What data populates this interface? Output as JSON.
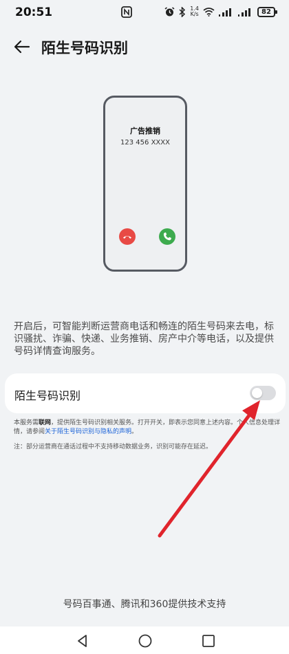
{
  "status_bar": {
    "time": "20:51",
    "net_speed_value": "1.4",
    "net_speed_unit": "K/s",
    "battery": "82"
  },
  "header": {
    "title": "陌生号码识别"
  },
  "phone_illustration": {
    "caller_name": "广告推销",
    "caller_number": "123 456 XXXX"
  },
  "description": "开启后，可智能判断运营商电话和畅连的陌生号码来去电，标识骚扰、诈骗、快递、业务推销、房产中介等电话，以及提供号码详情查询服务。",
  "setting": {
    "label": "陌生号码识别",
    "enabled": false
  },
  "notice": {
    "prefix": "本服务需",
    "bold": "联网",
    "middle": "，提供陌生号码识别相关服务。打开开关，即表示您同意上述内容。个人信息处理详情，请参阅",
    "link": "关于陌生号码识别与隐私的声明",
    "suffix": "。"
  },
  "note": "注：部分运营商在通话过程中不支持移动数据业务，识别可能存在延迟。",
  "footer": "号码百事通、腾讯和360提供技术支持",
  "colors": {
    "background": "#f1f3f5",
    "link": "#1a62d8",
    "hangup": "#e84a45",
    "answer": "#3dab4e",
    "annotation_arrow": "#e0242c"
  }
}
